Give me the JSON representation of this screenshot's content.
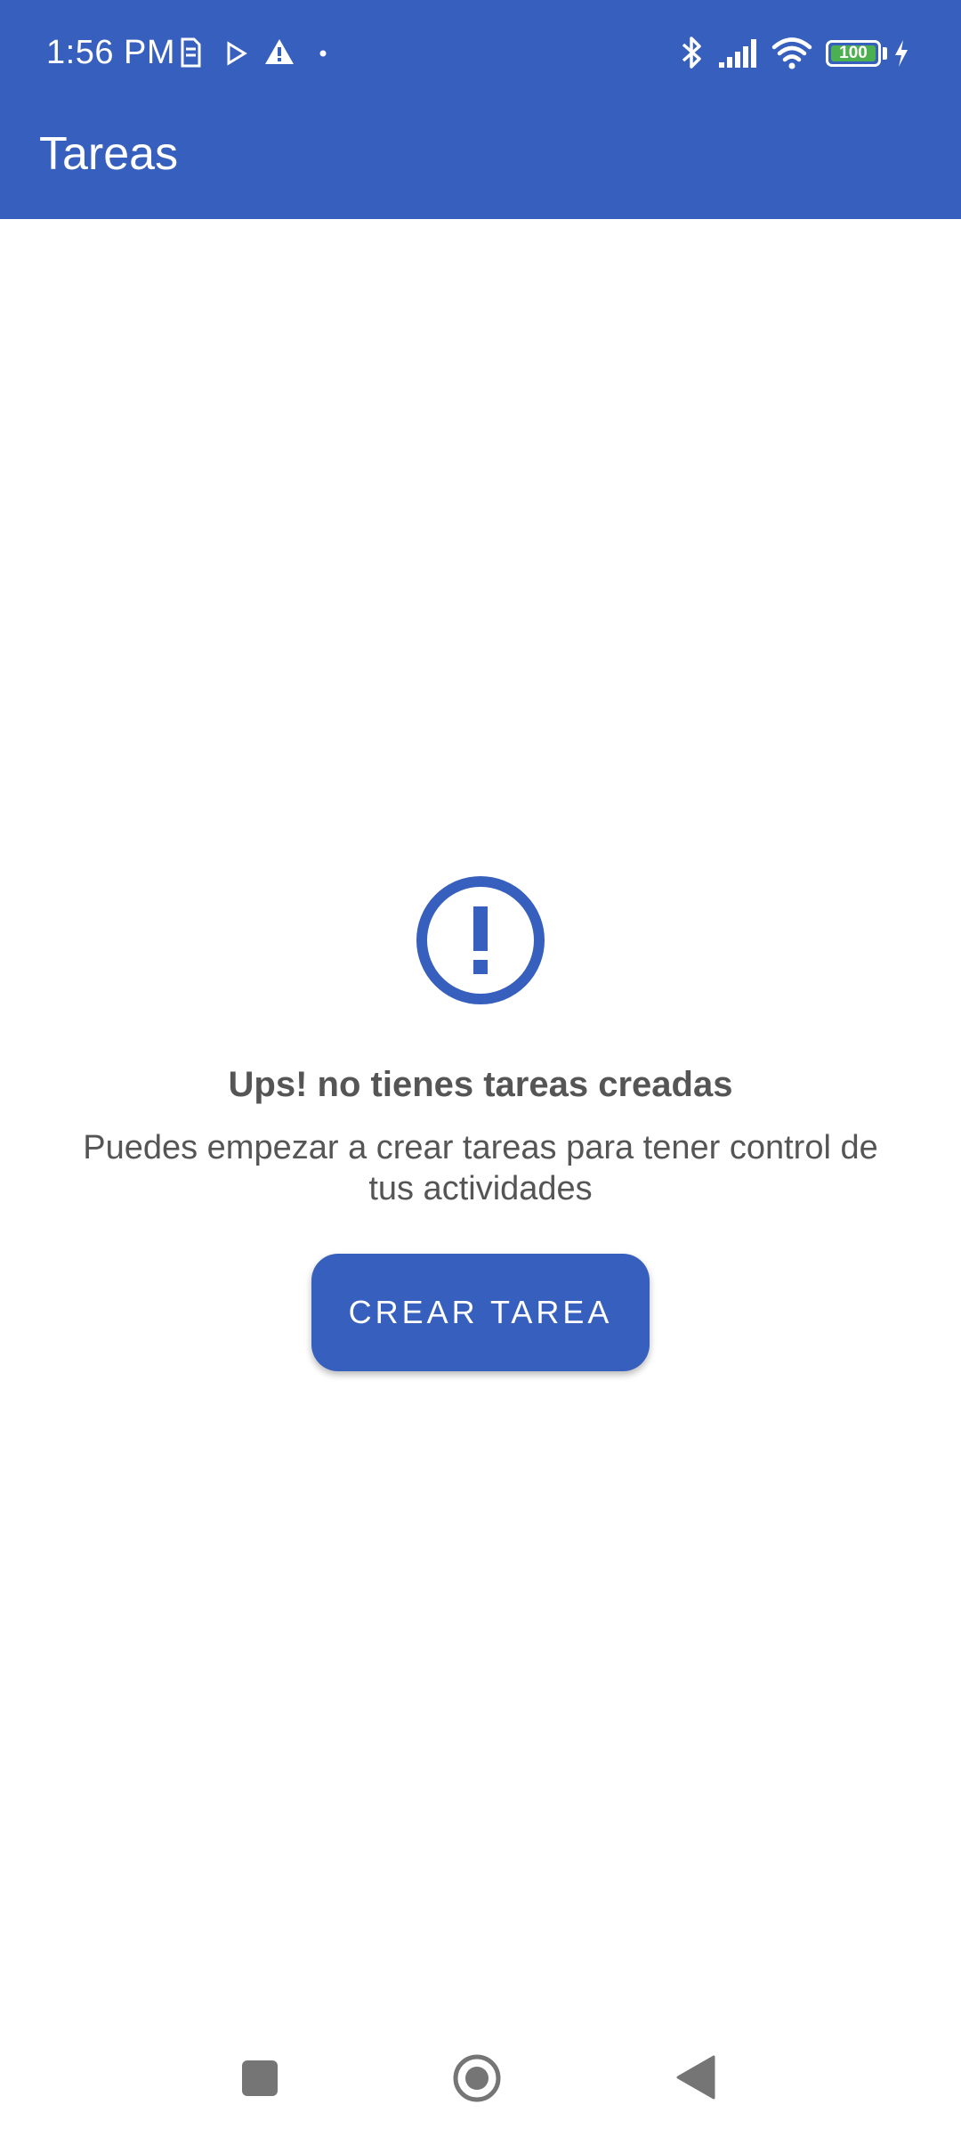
{
  "status_bar": {
    "time": "1:56 PM",
    "battery_level": "100",
    "battery_color": "#4CAF50",
    "icons": [
      "sim-icon",
      "play-icon",
      "warning-icon",
      "dot-icon",
      "bluetooth-icon",
      "signal-icon",
      "wifi-icon",
      "battery-icon",
      "charging-icon"
    ]
  },
  "app_bar": {
    "title": "Tareas",
    "background": "#375FBD"
  },
  "empty_state": {
    "icon": "alert-circle-icon",
    "title": "Ups! no tienes tareas creadas",
    "description": "Puedes empezar a crear tareas para tener control de tus actividades",
    "button_label": "CREAR TAREA"
  },
  "nav_bar": {
    "buttons": [
      "recents-button",
      "home-button",
      "back-button"
    ]
  }
}
